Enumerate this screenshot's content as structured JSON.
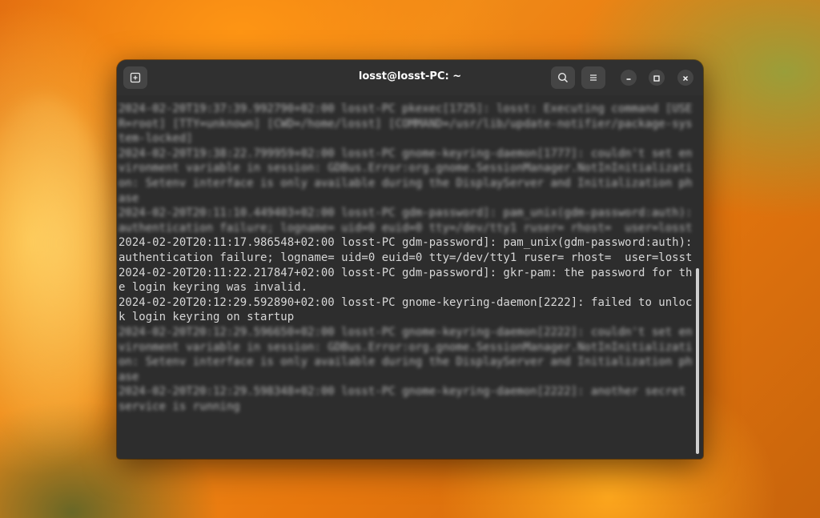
{
  "window": {
    "title": "losst@losst-PC: ~"
  },
  "icons": {
    "new_tab": "new-tab-icon",
    "search": "search-icon",
    "menu": "hamburger-menu-icon",
    "minimize": "minimize-icon",
    "maximize": "maximize-icon",
    "close": "close-icon"
  },
  "terminal": {
    "lines": [
      {
        "text": "2024-02-20T19:37:39.992790+02:00 losst-PC pkexec[1725]: losst: Executing command [USER=root] [TTY=unknown] [CWD=/home/losst] [COMMAND=/usr/lib/update-notifier/package-system-locked]",
        "blurred": true
      },
      {
        "text": "2024-02-20T19:38:22.799959+02:00 losst-PC gnome-keyring-daemon[1777]: couldn't set environment variable in session: GDBus.Error:org.gnome.SessionManager.NotInInitialization: Setenv interface is only available during the DisplayServer and Initialization phase",
        "blurred": true
      },
      {
        "text": "2024-02-20T20:11:10.449403+02:00 losst-PC gdm-password]: pam_unix(gdm-password:auth): authentication failure; logname= uid=0 euid=0 tty=/dev/tty1 ruser= rhost=  user=losst",
        "blurred": true
      },
      {
        "text": "2024-02-20T20:11:17.986548+02:00 losst-PC gdm-password]: pam_unix(gdm-password:auth): authentication failure; logname= uid=0 euid=0 tty=/dev/tty1 ruser= rhost=  user=losst",
        "blurred": false
      },
      {
        "text": "2024-02-20T20:11:22.217847+02:00 losst-PC gdm-password]: gkr-pam: the password for the login keyring was invalid.",
        "blurred": false
      },
      {
        "text": "2024-02-20T20:12:29.592890+02:00 losst-PC gnome-keyring-daemon[2222]: failed to unlock login keyring on startup",
        "blurred": false
      },
      {
        "text": "2024-02-20T20:12:29.596650+02:00 losst-PC gnome-keyring-daemon[2222]: couldn't set environment variable in session: GDBus.Error:org.gnome.SessionManager.NotInInitialization: Setenv interface is only available during the DisplayServer and Initialization phase",
        "blurred": true
      },
      {
        "text": "2024-02-20T20:12:29.598348+02:00 losst-PC gnome-keyring-daemon[2222]: another secret service is running",
        "blurred": true
      }
    ]
  },
  "colors": {
    "terminal_bg": "#2d2d2d",
    "titlebar_bg": "#303030",
    "text": "#d6d6d6"
  }
}
